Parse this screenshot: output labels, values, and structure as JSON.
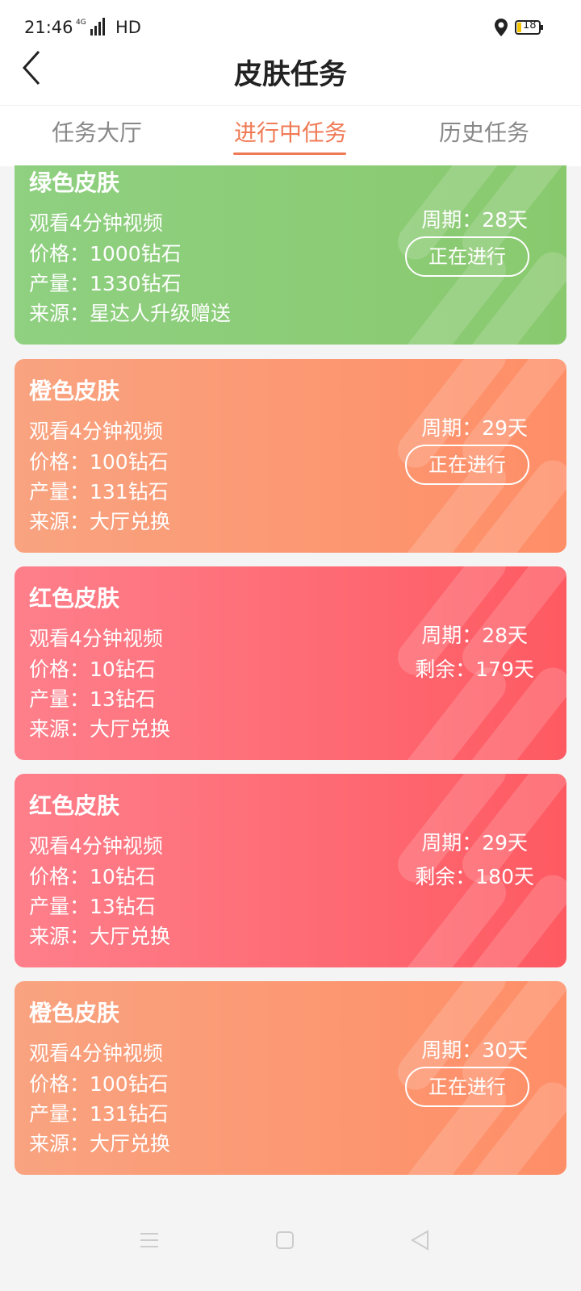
{
  "status_bar": {
    "time": "21:46",
    "network": "4G",
    "hd": "HD",
    "battery": "18"
  },
  "header": {
    "title": "皮肤任务"
  },
  "tabs": [
    {
      "label": "任务大厅",
      "active": false
    },
    {
      "label": "进行中任务",
      "active": true
    },
    {
      "label": "历史任务",
      "active": false
    }
  ],
  "tasks": [
    {
      "name": "绿色皮肤",
      "watch": "观看4分钟视频",
      "price": "价格：1000钻石",
      "output": "产量：1330钻石",
      "source": "来源：星达人升级赠送",
      "period": "周期：28天",
      "status": "正在进行",
      "color": "green"
    },
    {
      "name": "橙色皮肤",
      "watch": "观看4分钟视频",
      "price": "价格：100钻石",
      "output": "产量：131钻石",
      "source": "来源：大厅兑换",
      "period": "周期：29天",
      "status": "正在进行",
      "color": "orange"
    },
    {
      "name": "红色皮肤",
      "watch": "观看4分钟视频",
      "price": "价格：10钻石",
      "output": "产量：13钻石",
      "source": "来源：大厅兑换",
      "period": "周期：28天",
      "remaining": "剩余：179天",
      "color": "red"
    },
    {
      "name": "红色皮肤",
      "watch": "观看4分钟视频",
      "price": "价格：10钻石",
      "output": "产量：13钻石",
      "source": "来源：大厅兑换",
      "period": "周期：29天",
      "remaining": "剩余：180天",
      "color": "red"
    },
    {
      "name": "橙色皮肤",
      "watch": "观看4分钟视频",
      "price": "价格：100钻石",
      "output": "产量：131钻石",
      "source": "来源：大厅兑换",
      "period": "周期：30天",
      "status": "正在进行",
      "color": "orange"
    }
  ],
  "nav_icons": [
    "menu-icon",
    "home-icon",
    "back-icon"
  ],
  "colors": {
    "accent": "#f07a55",
    "green": "#8fd081",
    "orange": "#fe8e67",
    "red": "#fe5a62"
  }
}
